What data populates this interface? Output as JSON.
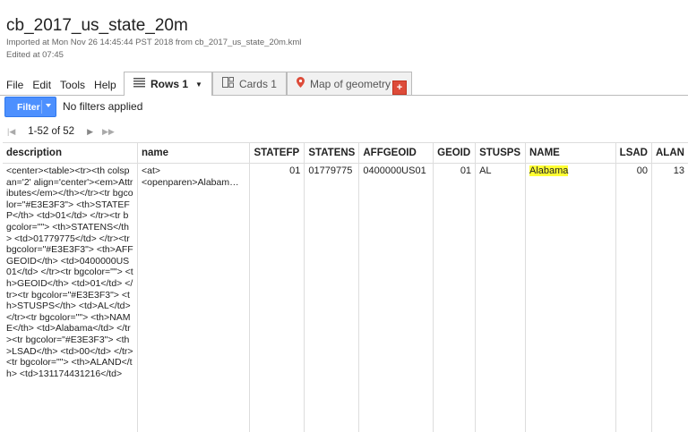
{
  "header": {
    "title": "cb_2017_us_state_20m",
    "imported": "Imported at Mon Nov 26 14:45:44 PST 2018 from cb_2017_us_state_20m.kml",
    "edited": "Edited at 07:45"
  },
  "menu": [
    "File",
    "Edit",
    "Tools",
    "Help"
  ],
  "tabs": {
    "rows": "Rows 1",
    "cards": "Cards 1",
    "map": "Map of geometry",
    "add": "+"
  },
  "filter": {
    "button": "Filter",
    "status": "No filters applied"
  },
  "pager": {
    "range": "1-52 of 52"
  },
  "columns": [
    "description",
    "name",
    "STATEFP",
    "STATENS",
    "AFFGEOID",
    "GEOID",
    "STUSPS",
    "NAME",
    "LSAD",
    "ALAN"
  ],
  "row": {
    "description": "<center><table><tr><th colspan='2' align='center'><em>Attributes</em></th></tr><tr bgcolor=\"#E3E3F3\"> <th>STATEFP</th> <td>01</td> </tr><tr bgcolor=\"\"> <th>STATENS</th> <td>01779775</td> </tr><tr bgcolor=\"#E3E3F3\"> <th>AFFGEOID</th> <td>0400000US01</td> </tr><tr bgcolor=\"\"> <th>GEOID</th> <td>01</td> </tr><tr bgcolor=\"#E3E3F3\"> <th>STUSPS</th> <td>AL</td> </tr><tr bgcolor=\"\"> <th>NAME</th> <td>Alabama</td> </tr><tr bgcolor=\"#E3E3F3\"> <th>LSAD</th> <td>00</td> </tr><tr bgcolor=\"\"> <th>ALAND</th> <td>131174431216</td>",
    "name_line1": "<at>",
    "name_line2": "<openparen>Alabam…",
    "STATEFP": "01",
    "STATENS": "01779775",
    "AFFGEOID": "0400000US01",
    "GEOID": "01",
    "STUSPS": "AL",
    "NAME": "Alabama",
    "LSAD": "00",
    "ALAND": "13"
  },
  "colors": {
    "filter_button": "#4d90fe",
    "add_tab": "#dd4b39",
    "highlight": "#ffff33"
  },
  "icons": [
    "rows-list-icon",
    "cards-icon",
    "map-pin-icon",
    "first-page-icon",
    "prev-page-icon",
    "next-page-icon",
    "last-page-icon",
    "dropdown-caret-icon"
  ]
}
